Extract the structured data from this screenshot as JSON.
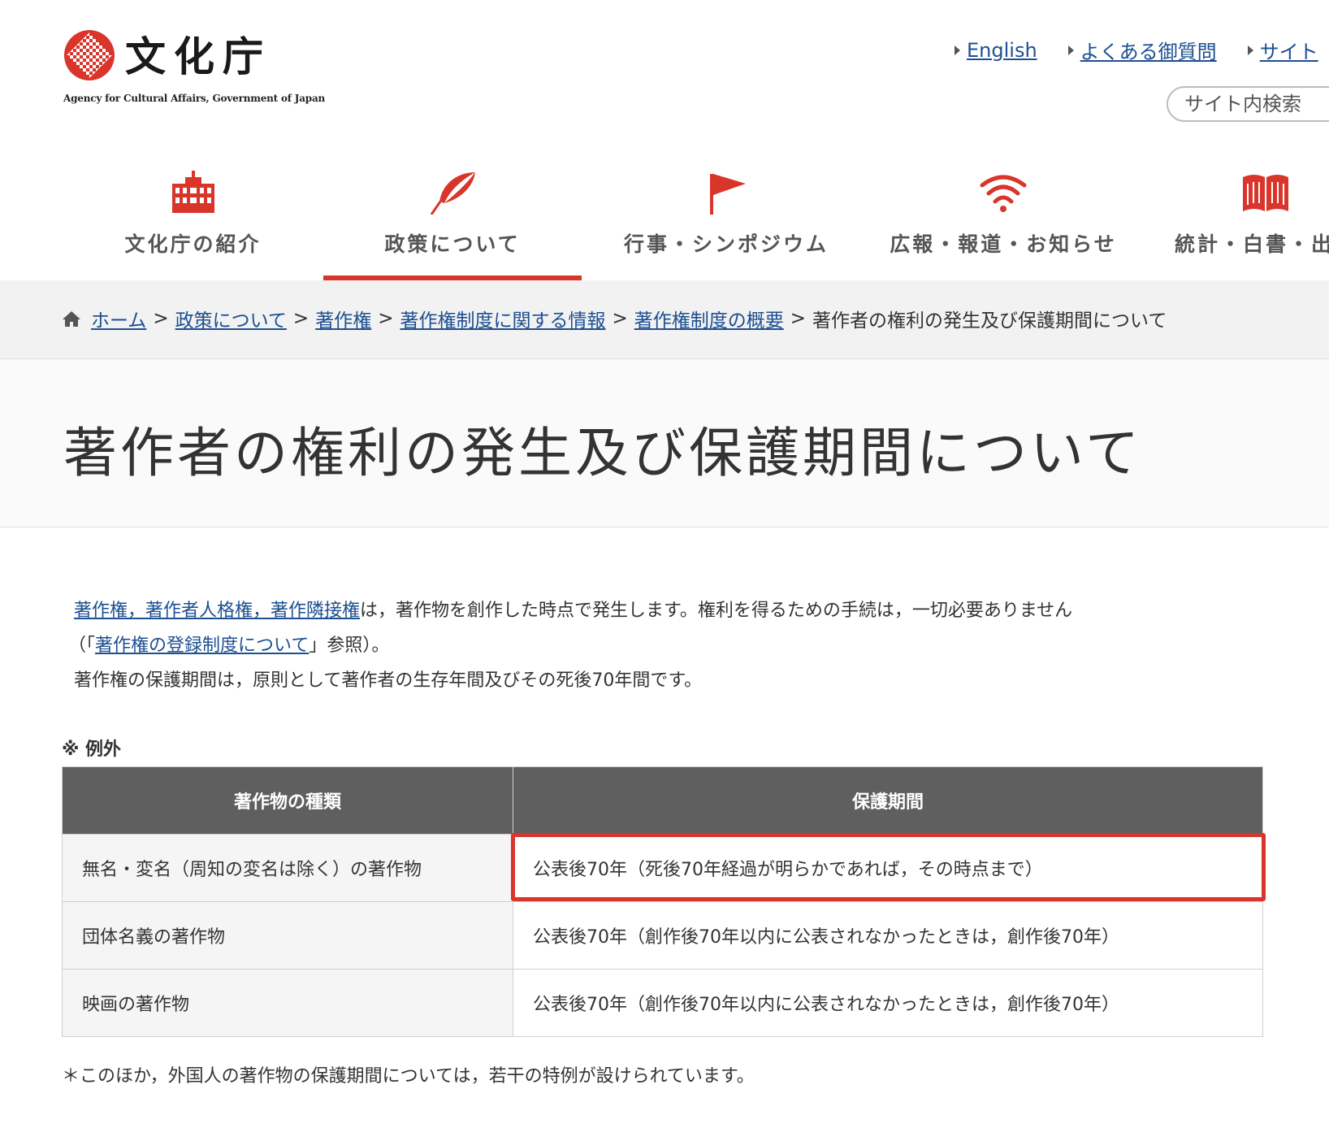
{
  "header": {
    "logo_text": "文化庁",
    "logo_subtitle": "Agency for Cultural Affairs, Government of Japan",
    "utility_links": [
      {
        "label": "English"
      },
      {
        "label": "よくある御質問"
      },
      {
        "label": "サイト"
      }
    ],
    "search_label": "サイト内検索"
  },
  "nav": {
    "items": [
      {
        "label": "文化庁の紹介",
        "icon": "building-icon"
      },
      {
        "label": "政策について",
        "icon": "feather-pen-icon",
        "active": true
      },
      {
        "label": "行事・シンポジウム",
        "icon": "flag-icon"
      },
      {
        "label": "広報・報道・お知らせ",
        "icon": "wifi-icon"
      },
      {
        "label": "統計・白書・出版",
        "icon": "book-icon"
      }
    ],
    "accent_color": "#d9352b"
  },
  "breadcrumb": {
    "items": [
      "ホーム",
      "政策について",
      "著作権",
      "著作権制度に関する情報",
      "著作権制度の概要"
    ],
    "current": "著作者の権利の発生及び保護期間について"
  },
  "page": {
    "title": "著作者の権利の発生及び保護期間について"
  },
  "intro": {
    "link1": "著作権，著作者人格権，著作隣接権",
    "text1": "は，著作物を創作した時点で発生します。権利を得るための手続は，一切必要ありません",
    "open_paren": "（「",
    "link2": "著作権の登録制度について",
    "text2": "」参照）。",
    "text3": "著作権の保護期間は，原則として著作者の生存年間及びその死後70年間です。"
  },
  "exception": {
    "label": "※ 例外",
    "headers": [
      "著作物の種類",
      "保護期間"
    ],
    "rows": [
      {
        "kind": "無名・変名（周知の変名は除く）の著作物",
        "period": "公表後70年（死後70年経過が明らかであれば，その時点まで）",
        "highlighted": true
      },
      {
        "kind": "団体名義の著作物",
        "period": "公表後70年（創作後70年以内に公表されなかったときは，創作後70年）"
      },
      {
        "kind": "映画の著作物",
        "period": "公表後70年（創作後70年以内に公表されなかったときは，創作後70年）"
      }
    ]
  },
  "footnote": "＊このほか，外国人の著作物の保護期間については，若干の特例が設けられています。"
}
